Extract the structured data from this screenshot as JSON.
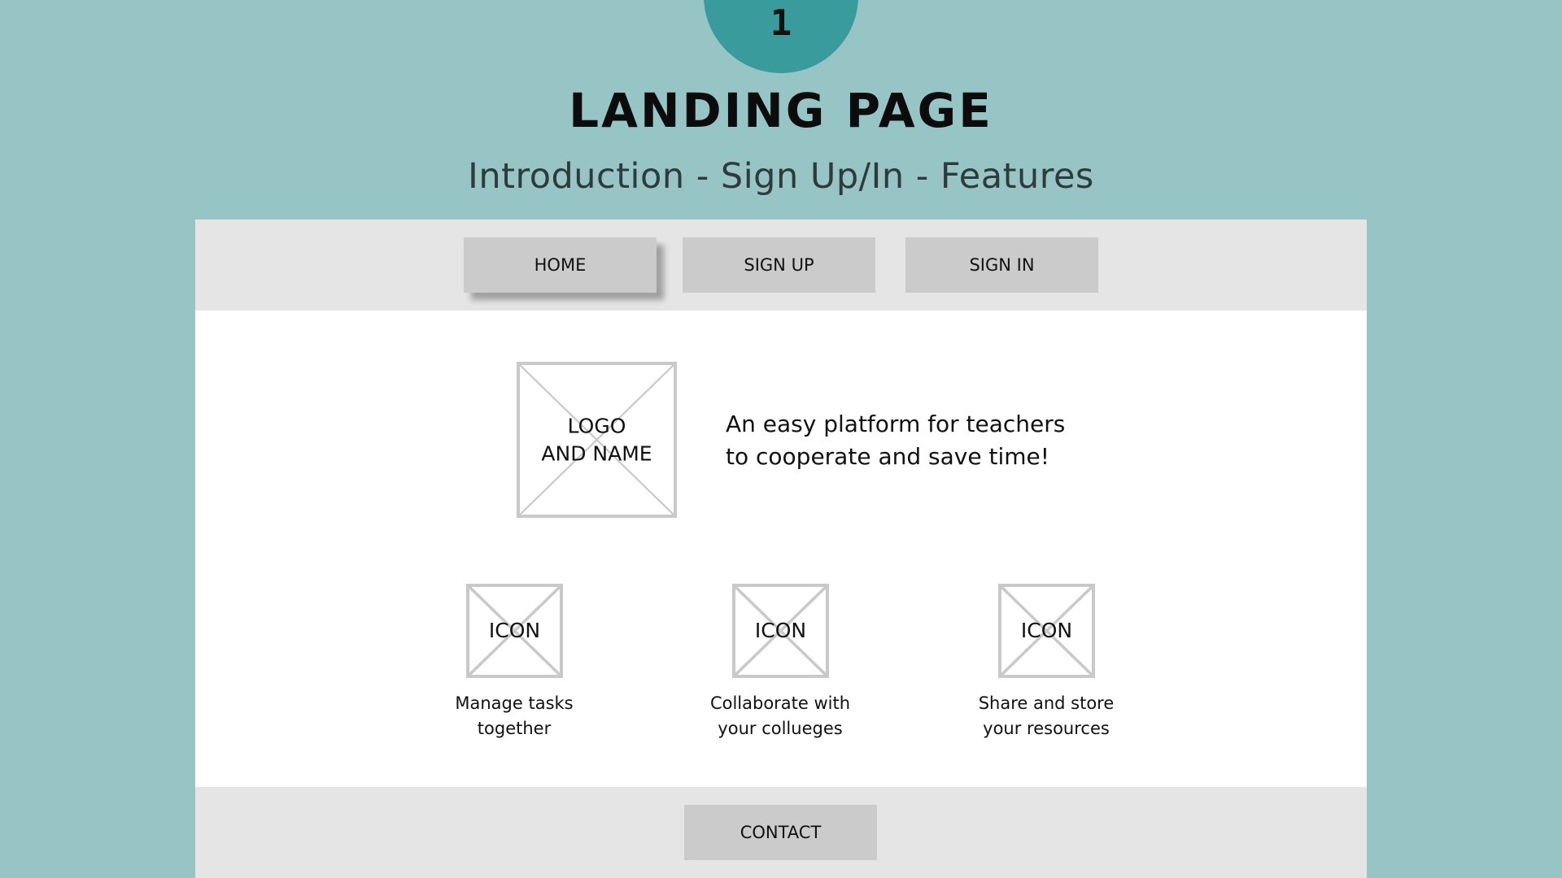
{
  "slide": {
    "step_number": "1",
    "title": "LANDING PAGE",
    "subtitle": "Introduction  -  Sign Up/In  -  Features"
  },
  "colors": {
    "background": "#97c4c5",
    "accent_circle": "#399b9c",
    "bar_gray": "#e5e5e5",
    "button_gray": "#cbcbcb",
    "placeholder_border": "#c9c9c9"
  },
  "navbar": {
    "home_label": "HOME",
    "signup_label": "SIGN UP",
    "signin_label": "SIGN IN",
    "active": "HOME"
  },
  "hero": {
    "logo_line1": "LOGO",
    "logo_line2": "AND NAME",
    "tagline_line1": "An easy platform for teachers",
    "tagline_line2": "to cooperate and save time!"
  },
  "features": [
    {
      "icon_label": "ICON",
      "caption_line1": "Manage tasks",
      "caption_line2": "together"
    },
    {
      "icon_label": "ICON",
      "caption_line1": "Collaborate with",
      "caption_line2": "your collueges"
    },
    {
      "icon_label": "ICON",
      "caption_line1": "Share and store",
      "caption_line2": "your resources"
    }
  ],
  "footer": {
    "contact_label": "CONTACT"
  }
}
